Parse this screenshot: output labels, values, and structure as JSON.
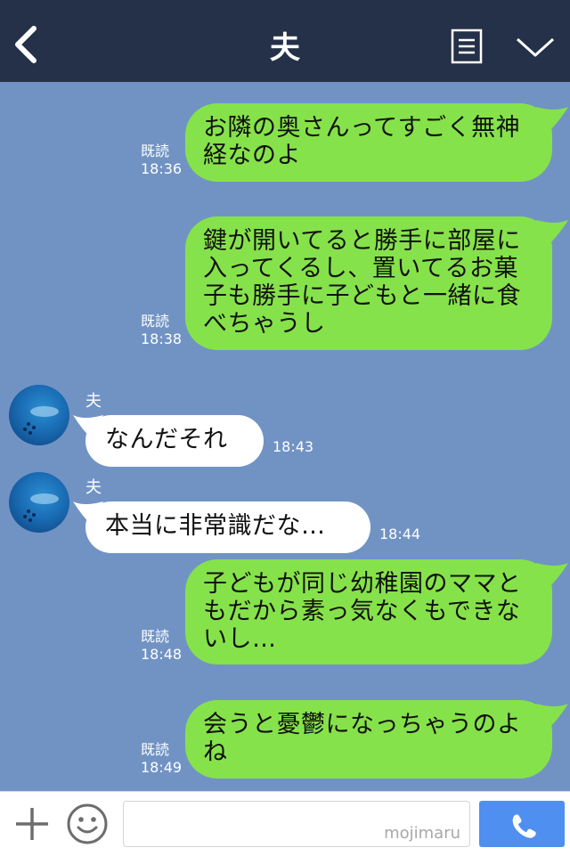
{
  "header": {
    "title": "夫"
  },
  "messages": [
    {
      "side": "sent",
      "text": "お隣の奥さんってすごく無神経なのよ",
      "read": "既読",
      "time": "18:36"
    },
    {
      "side": "sent",
      "text": "鍵が開いてると勝手に部屋に入ってくるし、置いてるお菓子も勝手に子どもと一緒に食べちゃうし",
      "read": "既読",
      "time": "18:38"
    },
    {
      "side": "recv",
      "sender": "夫",
      "text": "なんだそれ",
      "time": "18:43"
    },
    {
      "side": "recv",
      "sender": "夫",
      "text": "本当に非常識だな…",
      "time": "18:44"
    },
    {
      "side": "sent",
      "text": "子どもが同じ幼稚園のママともだから素っ気なくもできないし…",
      "read": "既読",
      "time": "18:48"
    },
    {
      "side": "sent",
      "text": "会うと憂鬱になっちゃうのよね",
      "read": "既読",
      "time": "18:49"
    }
  ],
  "footer": {
    "watermark": "mojimaru"
  },
  "icons": {
    "back": "chevron-left-icon",
    "menu": "list-icon",
    "collapse": "chevron-down-icon",
    "plus": "plus-icon",
    "emoji": "smiley-icon",
    "call": "phone-icon"
  },
  "colors": {
    "header_bg": "#253148",
    "chat_bg": "#7193c4",
    "sent_bubble": "#86e24a",
    "recv_bubble": "#ffffff",
    "call_button": "#4f8ff0"
  }
}
